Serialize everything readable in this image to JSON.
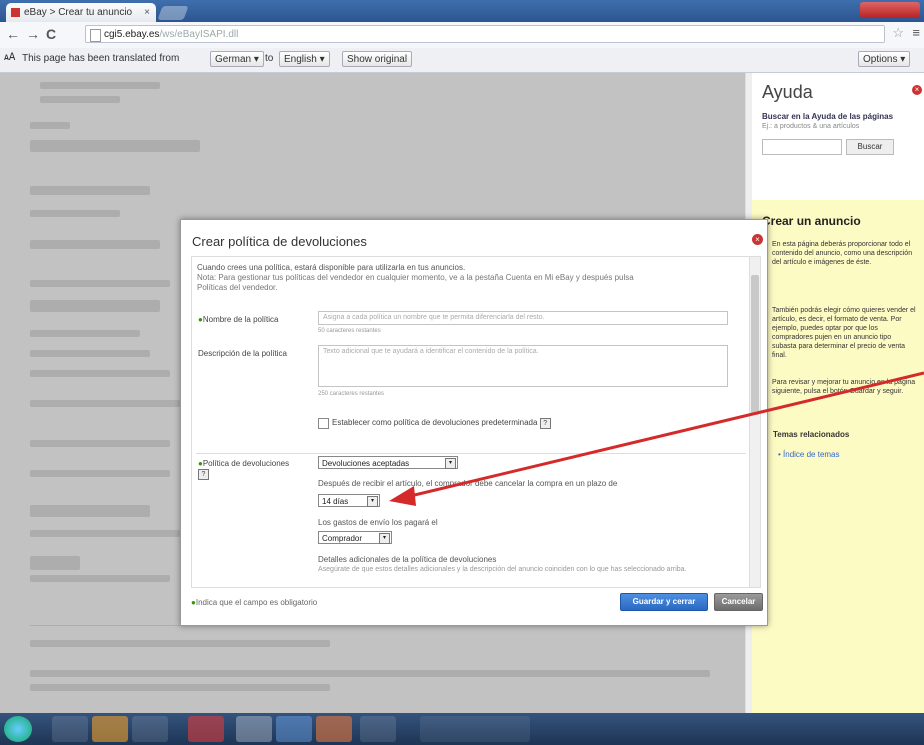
{
  "browser": {
    "tab_title": "eBay > Crear tu anuncio",
    "tab_close": "×",
    "url_host": "cgi5.ebay.es",
    "url_path": "/ws/eBayISAPI.dll",
    "translate_bar": {
      "message": "This page has been translated from",
      "from_lang": "German",
      "to_word": "to",
      "to_lang": "English",
      "show_original": "Show original",
      "options": "Options"
    }
  },
  "help_panel": {
    "title": "Ayuda",
    "search_label": "Buscar en la Ayuda de las páginas",
    "search_hint": "Ej.: a productos & una artículos",
    "search_button": "Buscar",
    "heading": "Crear un anuncio",
    "para1": "En esta página deberás proporcionar todo el contenido del anuncio, como una descripción del artículo e imágenes de éste.",
    "para2": "También podrás elegir cómo quieres vender el artículo, es decir, el formato de venta. Por ejemplo, puedes optar por que los compradores pujen en un anuncio tipo subasta para determinar el precio de venta final.",
    "para3": "Para revisar y mejorar tu anuncio en la página siguiente, pulsa el botón Guardar y seguir.",
    "related_heading": "Temas relacionados",
    "related_item": "Índice de temas"
  },
  "dialog": {
    "title": "Crear política de devoluciones",
    "intro_line1": "Cuando crees una política, estará disponible para utilizarla en tus anuncios.",
    "intro_line2": "Nota: Para gestionar tus políticas del vendedor en cualquier momento, ve a la pestaña Cuenta en Mi eBay y después pulsa",
    "intro_line3": "Políticas del vendedor.",
    "name_label": "Nombre de la política",
    "name_placeholder": "Asigna a cada política un nombre que te permita diferenciarla del resto.",
    "name_counter": "50 caracteres restantes",
    "desc_label": "Descripción de la política",
    "desc_placeholder": "Texto adicional que te ayudará a identificar el contenido de la política.",
    "desc_counter": "250 caracteres restantes",
    "default_checkbox_label": "Establecer como política de devoluciones predeterminada",
    "returns_label": "Política de devoluciones",
    "returns_value": "Devoluciones aceptadas",
    "returns_period_text": "Después de recibir el artículo, el comprador debe cancelar la compra en un plazo de",
    "returns_period_value": "14 días",
    "shipping_cost_label": "Los gastos de envío los pagará el",
    "shipping_cost_value": "Comprador",
    "details_label": "Detalles adicionales de la política de devoluciones",
    "details_hint": "Asegúrate de que estos detalles adicionales y la descripción del anuncio coinciden con lo que has seleccionado arriba.",
    "required_note": "Indica que el campo es obligatorio",
    "save_button": "Guardar y cerrar",
    "cancel_button": "Cancelar",
    "close_glyph": "×",
    "help_glyph": "?",
    "dropdown_glyph": "▾"
  },
  "colors": {
    "accent": "#2a69c2",
    "close_red": "#cc3333",
    "annotation_arrow": "#d42a2a",
    "help_yellow": "#fdfbc4"
  }
}
